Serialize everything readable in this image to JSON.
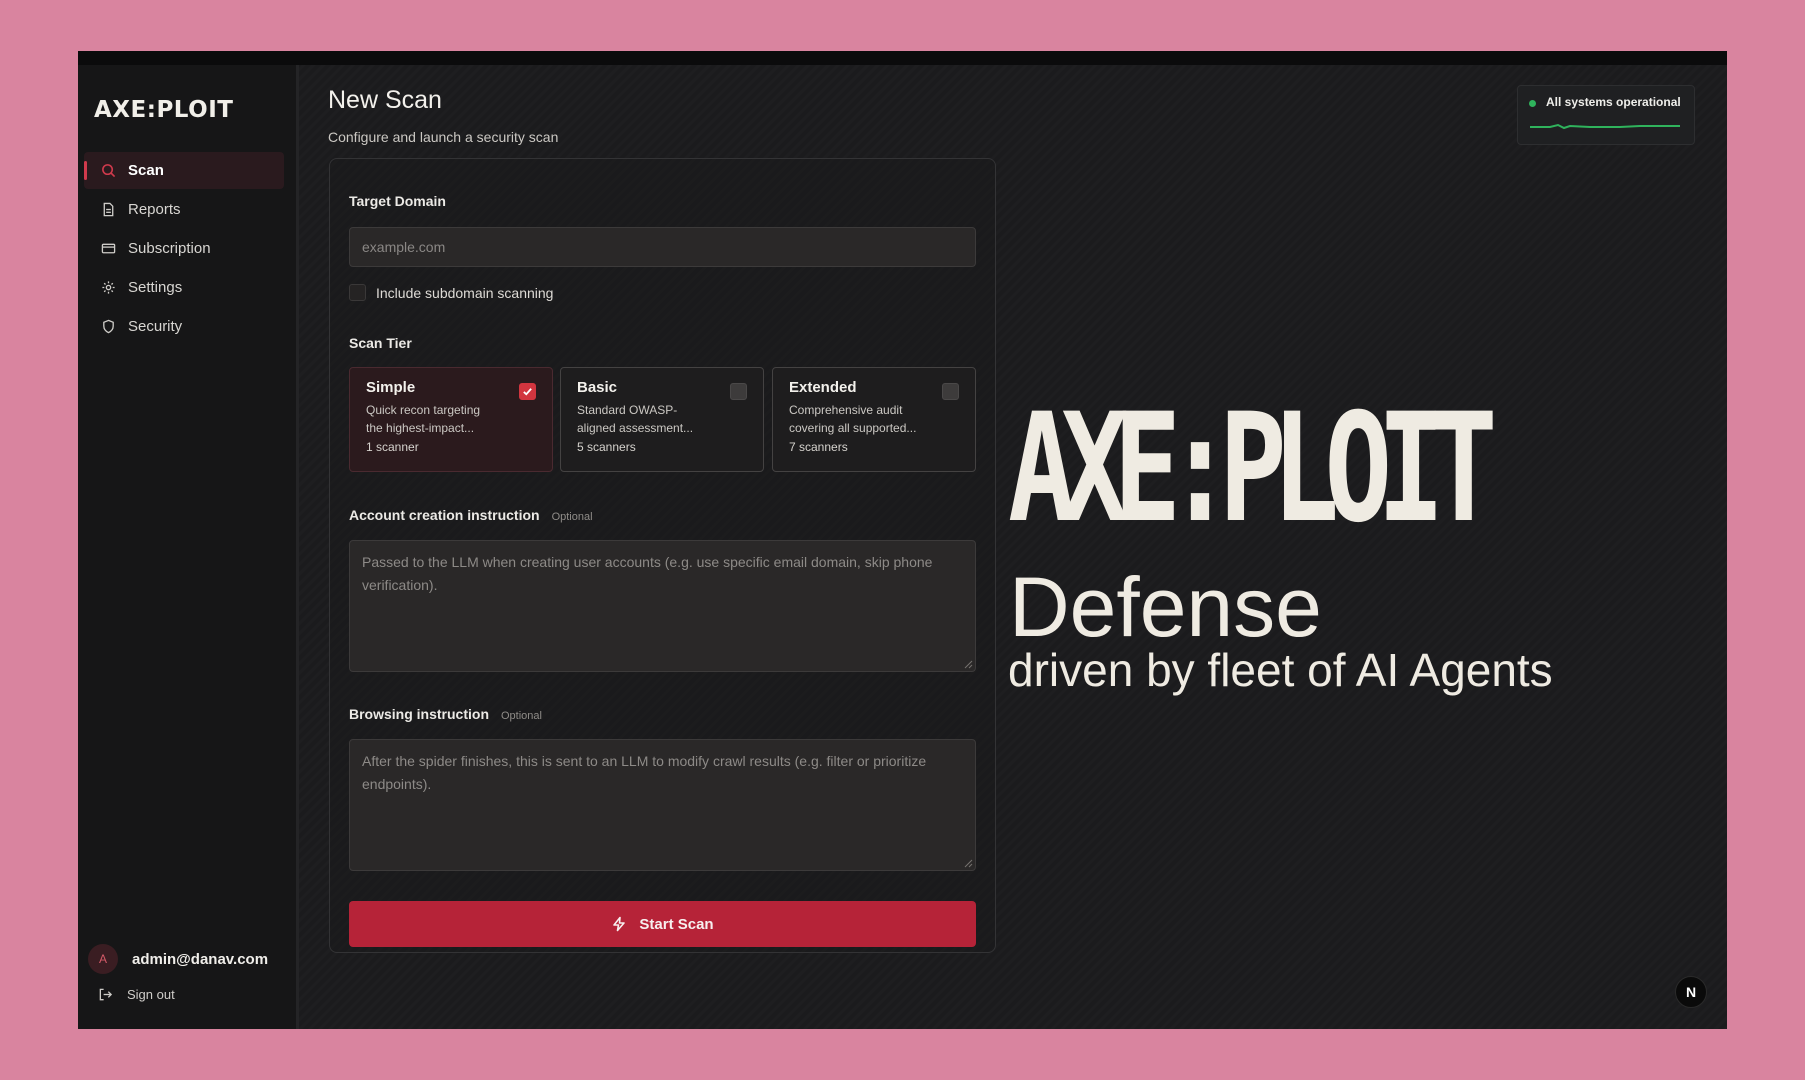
{
  "app": {
    "logo": "AXE:PLOIT",
    "accent_color": "#b62338"
  },
  "sidebar": {
    "items": [
      {
        "label": "Scan",
        "icon": "search-icon",
        "active": true
      },
      {
        "label": "Reports",
        "icon": "document-icon",
        "active": false
      },
      {
        "label": "Subscription",
        "icon": "credit-card-icon",
        "active": false
      },
      {
        "label": "Settings",
        "icon": "gear-icon",
        "active": false
      },
      {
        "label": "Security",
        "icon": "shield-icon",
        "active": false
      }
    ],
    "user": {
      "avatar_letter": "A",
      "email": "admin@danav.com"
    },
    "signout_label": "Sign out"
  },
  "header": {
    "title": "New Scan",
    "subtitle": "Configure and launch a security scan"
  },
  "status": {
    "text": "All systems operational",
    "color": "#2fb35c"
  },
  "form": {
    "target_label": "Target Domain",
    "target_placeholder": "example.com",
    "subdomain_label": "Include subdomain scanning",
    "subdomain_checked": false,
    "tier_label": "Scan Tier",
    "tiers": [
      {
        "name": "Simple",
        "desc": "Quick recon targeting the highest-impact...",
        "count": "1 scanner",
        "selected": true
      },
      {
        "name": "Basic",
        "desc": "Standard OWASP-aligned assessment...",
        "count": "5 scanners",
        "selected": false
      },
      {
        "name": "Extended",
        "desc": "Comprehensive audit covering all supported...",
        "count": "7 scanners",
        "selected": false
      }
    ],
    "account_label": "Account creation instruction",
    "account_optional": "Optional",
    "account_placeholder": "Passed to the LLM when creating user accounts (e.g. use specific email domain, skip phone verification).",
    "browsing_label": "Browsing instruction",
    "browsing_optional": "Optional",
    "browsing_placeholder": "After the spider finishes, this is sent to an LLM to modify crawl results (e.g. filter or prioritize endpoints).",
    "start_label": "Start Scan"
  },
  "hero": {
    "title": "AXE:PLOIT",
    "line1": "Defense",
    "line2": "driven by fleet of AI Agents"
  },
  "badge": {
    "text": "N"
  }
}
